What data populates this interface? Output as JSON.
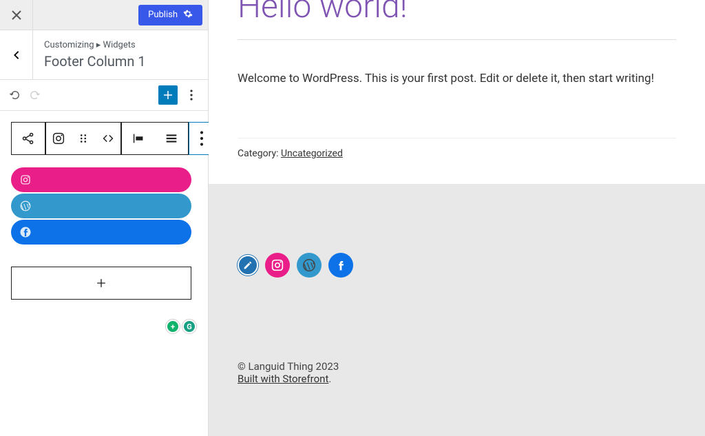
{
  "header": {
    "publish_label": "Publish"
  },
  "breadcrumb": {
    "parent": "Customizing",
    "separator": "▸",
    "section": "Widgets",
    "title": "Footer Column 1"
  },
  "social_items": [
    {
      "name": "instagram",
      "color": "#e91e88"
    },
    {
      "name": "wordpress",
      "color": "#3399cc"
    },
    {
      "name": "facebook",
      "color": "#0d72e8"
    }
  ],
  "post": {
    "title": "Hello world!",
    "content": "Welcome to WordPress. This is your first post. Edit or delete it, then start writing!",
    "category_label": "Category: ",
    "category_value": "Uncategorized"
  },
  "footer": {
    "copyright": "© Languid Thing 2023",
    "credit_link": "Built with Storefront",
    "credit_suffix": "."
  }
}
